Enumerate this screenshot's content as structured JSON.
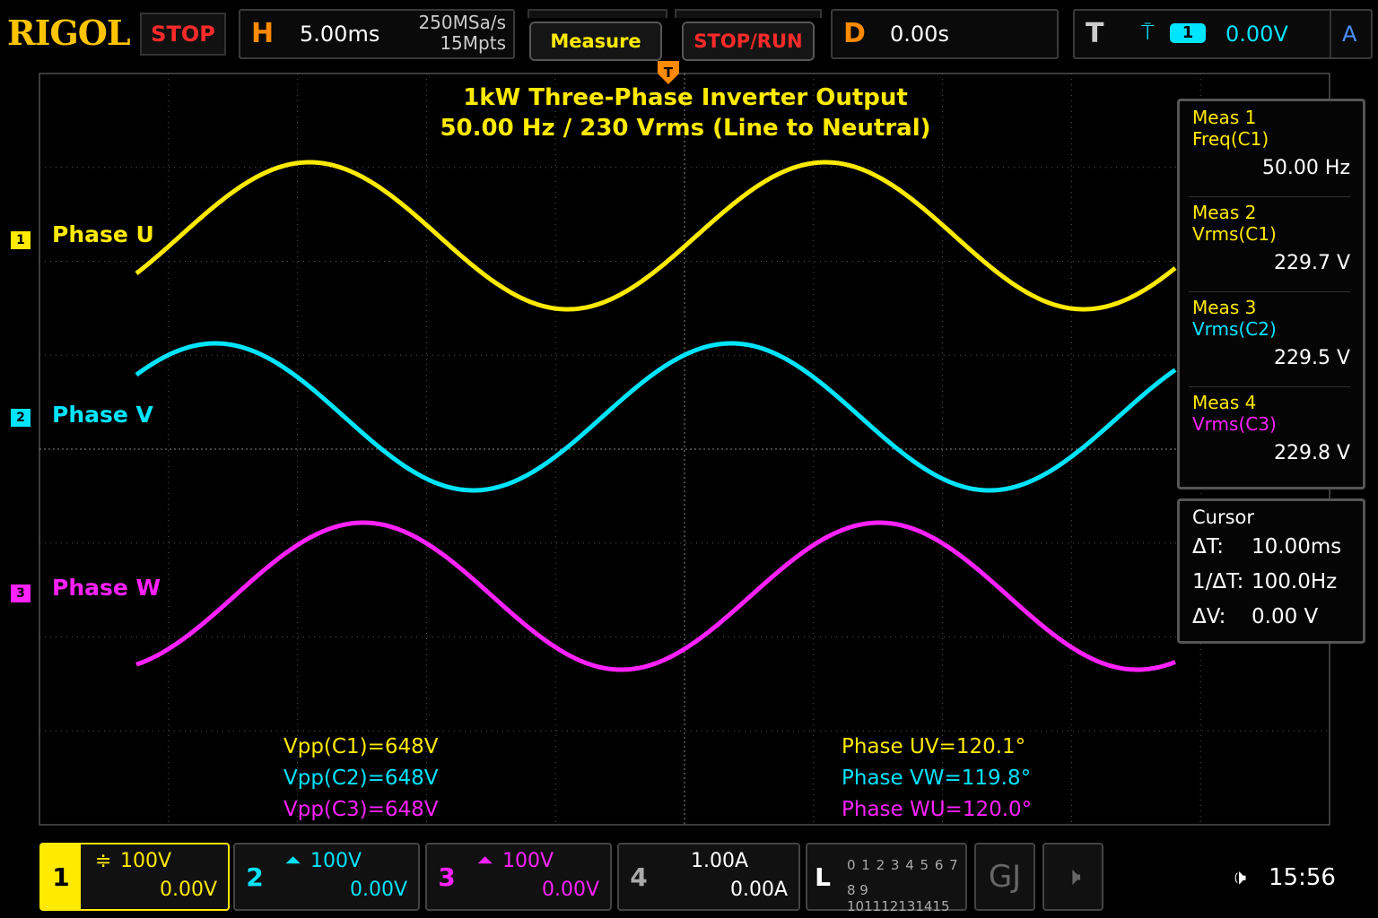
{
  "top": {
    "brand": "RIGOL",
    "state": "STOP",
    "horizontal": {
      "letter": "H",
      "timebase": "5.00ms",
      "sample_rate": "250MSa/s",
      "memory_depth": "15Mpts"
    },
    "measure_btn": "Measure",
    "stoprun_btn": "STOP/RUN",
    "delay": {
      "letter": "D",
      "value": "0.00s"
    },
    "trigger": {
      "letter": "T",
      "channel": "1",
      "level": "0.00V",
      "mode": "A"
    },
    "trigger_marker": "T"
  },
  "screen": {
    "title_line1": "1kW Three-Phase Inverter Output",
    "title_line2": "50.00 Hz / 230 Vrms (Line to Neutral)",
    "channels": [
      {
        "num": "1",
        "label": "Phase U",
        "color": "#ffea00"
      },
      {
        "num": "2",
        "label": "Phase V",
        "color": "#00e5ff"
      },
      {
        "num": "3",
        "label": "Phase W",
        "color": "#ff22ff"
      }
    ],
    "stats_left": [
      "Vpp(C1)=648V",
      "Vpp(C2)=648V",
      "Vpp(C3)=648V"
    ],
    "stats_right": [
      "Phase UV=120.1°",
      "Phase VW=119.8°",
      "Phase WU=120.0°"
    ]
  },
  "measurements": [
    {
      "title": "Meas 1",
      "name": "Freq(C1)",
      "value": "50.00 Hz",
      "name_color": "#ffea00"
    },
    {
      "title": "Meas 2",
      "name": "Vrms(C1)",
      "value": "229.7 V",
      "name_color": "#ffea00"
    },
    {
      "title": "Meas 3",
      "name": "Vrms(C2)",
      "value": "229.5 V",
      "name_color": "#00e5ff"
    },
    {
      "title": "Meas 4",
      "name": "Vrms(C3)",
      "value": "229.8 V",
      "name_color": "#ff22ff"
    }
  ],
  "cursor": {
    "title": "Cursor",
    "dt_label": "ΔT:",
    "dt": "10.00ms",
    "inv_label": "1/ΔT:",
    "inv": "100.0Hz",
    "dv_label": "ΔV:",
    "dv": "0.00 V"
  },
  "bottom": {
    "ch1": {
      "num": "1",
      "scale": "100V",
      "offset": "0.00V"
    },
    "ch2": {
      "num": "2",
      "scale": "100V",
      "offset": "0.00V"
    },
    "ch3": {
      "num": "3",
      "scale": "100V",
      "offset": "0.00V"
    },
    "ch4": {
      "num": "4",
      "scale": "1.00A",
      "offset": "0.00A"
    },
    "logic": {
      "letter": "L",
      "row1": "0 1 2 3 4 5 6 7",
      "row2": "8 9 101112131415"
    },
    "clock": "15:56"
  },
  "waveform": {
    "frequency_hz": 50,
    "timebase_ms_per_div": 5.0,
    "phase_deg": [
      0,
      -120,
      -240
    ]
  }
}
